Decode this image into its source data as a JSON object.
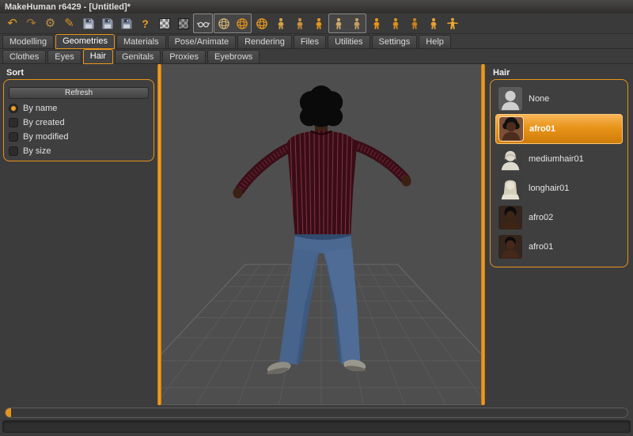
{
  "window": {
    "title": "MakeHuman r6429 - [Untitled]*"
  },
  "colors": {
    "accent": "#e8941a",
    "selection_gradient_top": "#f8b658",
    "selection_gradient_bottom": "#cf7c09",
    "panel_bg": "#3c3c3c",
    "viewport_bg": "#4e4e4e"
  },
  "toolbar": {
    "icons": [
      "undo",
      "redo",
      "gear",
      "edit-pencil",
      "save",
      "load",
      "export",
      "help",
      "background-checker",
      "texture-checker",
      "glasses-toggle",
      "wireframe-sphere",
      "smooth-sphere",
      "mesh-globe",
      "skeleton",
      "skeleton-pose",
      "skin",
      "pose-glasses",
      "pose-eyes",
      "proxy",
      "body",
      "measure",
      "reset-pose",
      "tpose"
    ]
  },
  "main_tabs": {
    "items": [
      "Modelling",
      "Geometries",
      "Materials",
      "Pose/Animate",
      "Rendering",
      "Files",
      "Utilities",
      "Settings",
      "Help"
    ],
    "active": "Geometries"
  },
  "sub_tabs": {
    "items": [
      "Clothes",
      "Eyes",
      "Hair",
      "Genitals",
      "Proxies",
      "Eyebrows"
    ],
    "active": "Hair"
  },
  "sort_panel": {
    "title": "Sort",
    "refresh": "Refresh",
    "options": [
      {
        "label": "By name",
        "selected": true
      },
      {
        "label": "By created",
        "selected": false
      },
      {
        "label": "By modified",
        "selected": false
      },
      {
        "label": "By size",
        "selected": false
      }
    ]
  },
  "hair_panel": {
    "title": "Hair",
    "items": [
      {
        "label": "None",
        "selected": false
      },
      {
        "label": "afro01",
        "selected": true
      },
      {
        "label": "mediumhair01",
        "selected": false
      },
      {
        "label": "longhair01",
        "selected": false
      },
      {
        "label": "afro02",
        "selected": false
      },
      {
        "label": "afro01",
        "selected": false
      }
    ]
  }
}
